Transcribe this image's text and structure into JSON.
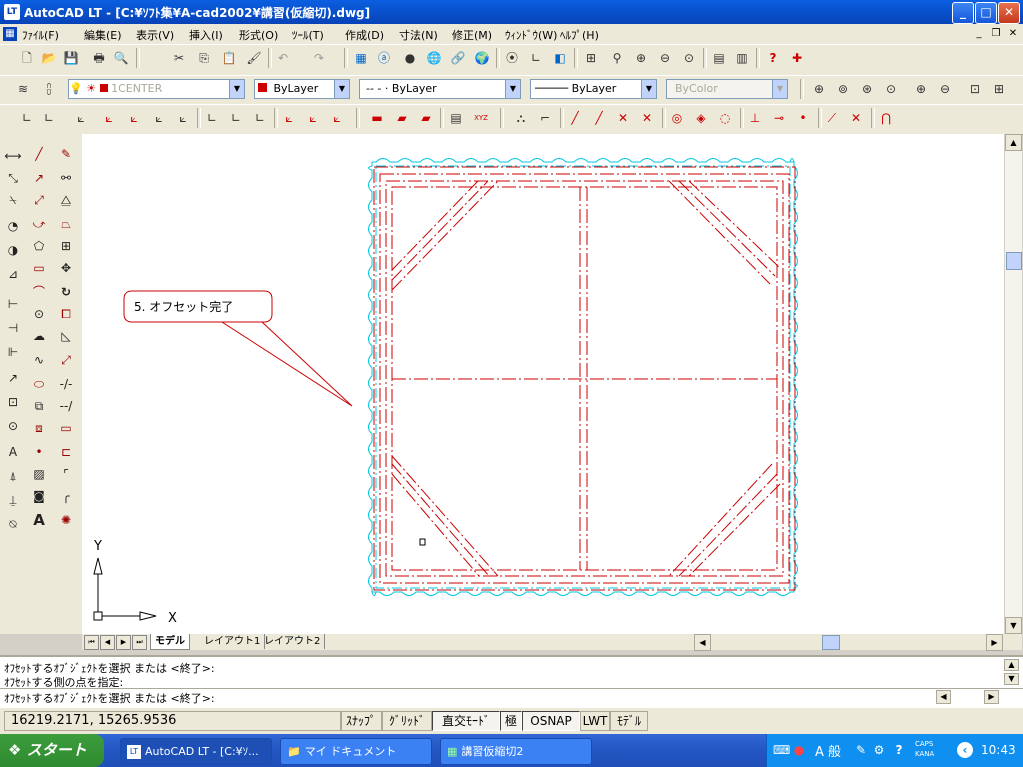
{
  "window": {
    "app_icon": "LT",
    "title": "AutoCAD LT - [C:¥ｿﾌﾄ集¥A-cad2002¥講習(仮縮切).dwg]",
    "controls": [
      "minimize-icon",
      "maximize-icon",
      "close-icon"
    ]
  },
  "menu": {
    "items": [
      "ﾌｧｲﾙ(F)",
      "編集(E)",
      "表示(V)",
      "挿入(I)",
      "形式(O)",
      "ﾂｰﾙ(T)",
      "作成(D)",
      "寸法(N)",
      "修正(M)",
      "ｳｨﾝﾄﾞｳ(W)",
      "ﾍﾙﾌﾟ(H)"
    ]
  },
  "layers": {
    "current_layer": "1CENTER",
    "color": "ByLayer",
    "linetype": "-- - · ByLayer",
    "lineweight": "ByLayer",
    "plotstyle": "ByColor"
  },
  "drawing": {
    "callout_text": "5. オフセット完了",
    "ucs_x": "X",
    "ucs_y": "Y",
    "colors": {
      "red": "#cc0000",
      "cyan": "#00c8e0"
    }
  },
  "tabs": [
    "モデル",
    "レイアウト1",
    "レイアウト2"
  ],
  "command": {
    "lines": [
      "ｵﾌｾｯﾄするｵﾌﾞｼﾞｪｸﾄを選択 または <終了>:",
      "ｵﾌｾｯﾄする側の点を指定:",
      "ｵﾌｾｯﾄするｵﾌﾞｼﾞｪｸﾄを選択 または <終了>:"
    ]
  },
  "status": {
    "coords": "16219.2171, 15265.9536",
    "buttons": [
      "ｽﾅｯﾌﾟ",
      "ｸﾞﾘｯﾄﾞ",
      "直交ﾓｰﾄﾞ",
      "極",
      "OSNAP",
      "LWT",
      "ﾓﾃﾞﾙ"
    ]
  },
  "taskbar": {
    "start": "スタート",
    "items": [
      "AutoCAD LT - [C:¥ｿ...",
      "マイ ドキュメント",
      "講習仮縮切2"
    ],
    "ime": "A 般",
    "caps": "CAPS",
    "kana": "KANA",
    "clock": "10:43"
  }
}
